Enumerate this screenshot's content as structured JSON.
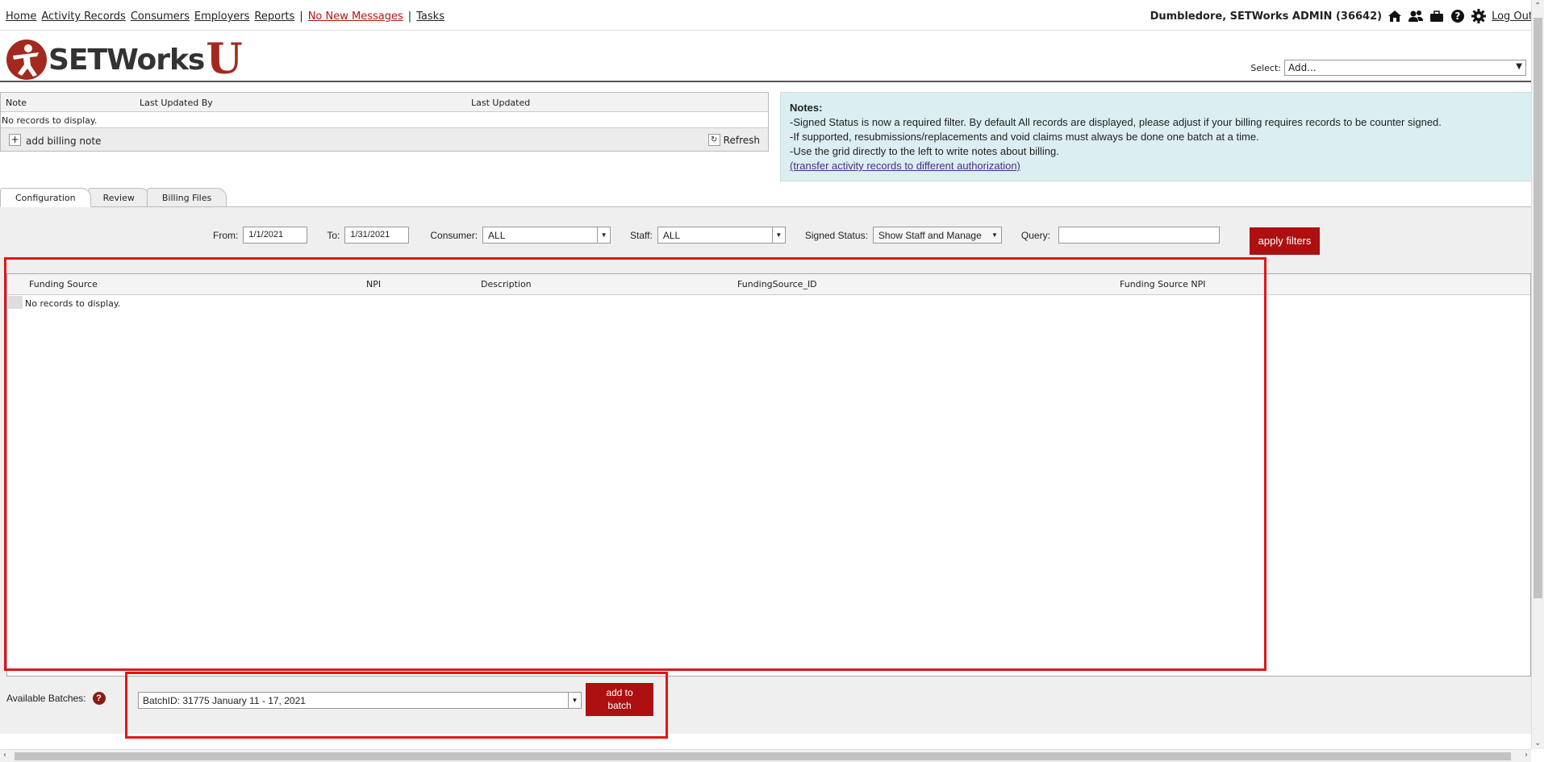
{
  "topnav": {
    "items": [
      "Home",
      "Activity Records",
      "Consumers",
      "Employers",
      "Reports"
    ],
    "separator": "|",
    "messages": "No New Messages",
    "tasks": "Tasks"
  },
  "user": {
    "name": "Dumbledore, SETWorks ADMIN",
    "id": "(36642)",
    "logout": "Log Out"
  },
  "icons": [
    "home-icon",
    "people-icon",
    "briefcase-icon",
    "help-icon",
    "gear-icon"
  ],
  "logo": {
    "text": "SETWorks",
    "letter": "U"
  },
  "select": {
    "label": "Select:",
    "value": "Add..."
  },
  "notes_grid": {
    "columns": [
      "Note",
      "Last Updated By",
      "Last Updated"
    ],
    "empty": "No records to display.",
    "add_label": "add billing note",
    "refresh_label": "Refresh"
  },
  "notes_panel": {
    "title": "Notes:",
    "lines": [
      "-Signed Status is now a required filter. By default All records are displayed, please adjust if your billing requires records to be counter signed.",
      "-If supported, resubmissions/replacements and void claims must always be done one batch at a time.",
      "-Use the grid directly to the left to write notes about billing."
    ],
    "link": "(transfer activity records to different authorization)"
  },
  "tabs": [
    "Configuration",
    "Review",
    "Billing Files"
  ],
  "filters": {
    "from_label": "From:",
    "from_value": "1/1/2021",
    "to_label": "To:",
    "to_value": "1/31/2021",
    "consumer_label": "Consumer:",
    "consumer_value": "ALL",
    "staff_label": "Staff:",
    "staff_value": "ALL",
    "signed_label": "Signed Status:",
    "signed_value": "Show Staff and Manage",
    "query_label": "Query:",
    "query_value": "",
    "apply_label": "apply filters"
  },
  "main_grid": {
    "columns": [
      "Funding Source",
      "NPI",
      "Description",
      "FundingSource_ID",
      "Funding Source NPI"
    ],
    "empty": "No records to display."
  },
  "batches": {
    "label": "Available Batches:",
    "help": "?",
    "value": "BatchID: 31775 January 11 - 17, 2021",
    "add_label_1": "add to",
    "add_label_2": "batch"
  },
  "colors": {
    "brand": "#a3291e",
    "button": "#ad1010",
    "notes_bg": "#dbeef2",
    "highlight": "#e3151a",
    "link": "#4b2c86"
  }
}
